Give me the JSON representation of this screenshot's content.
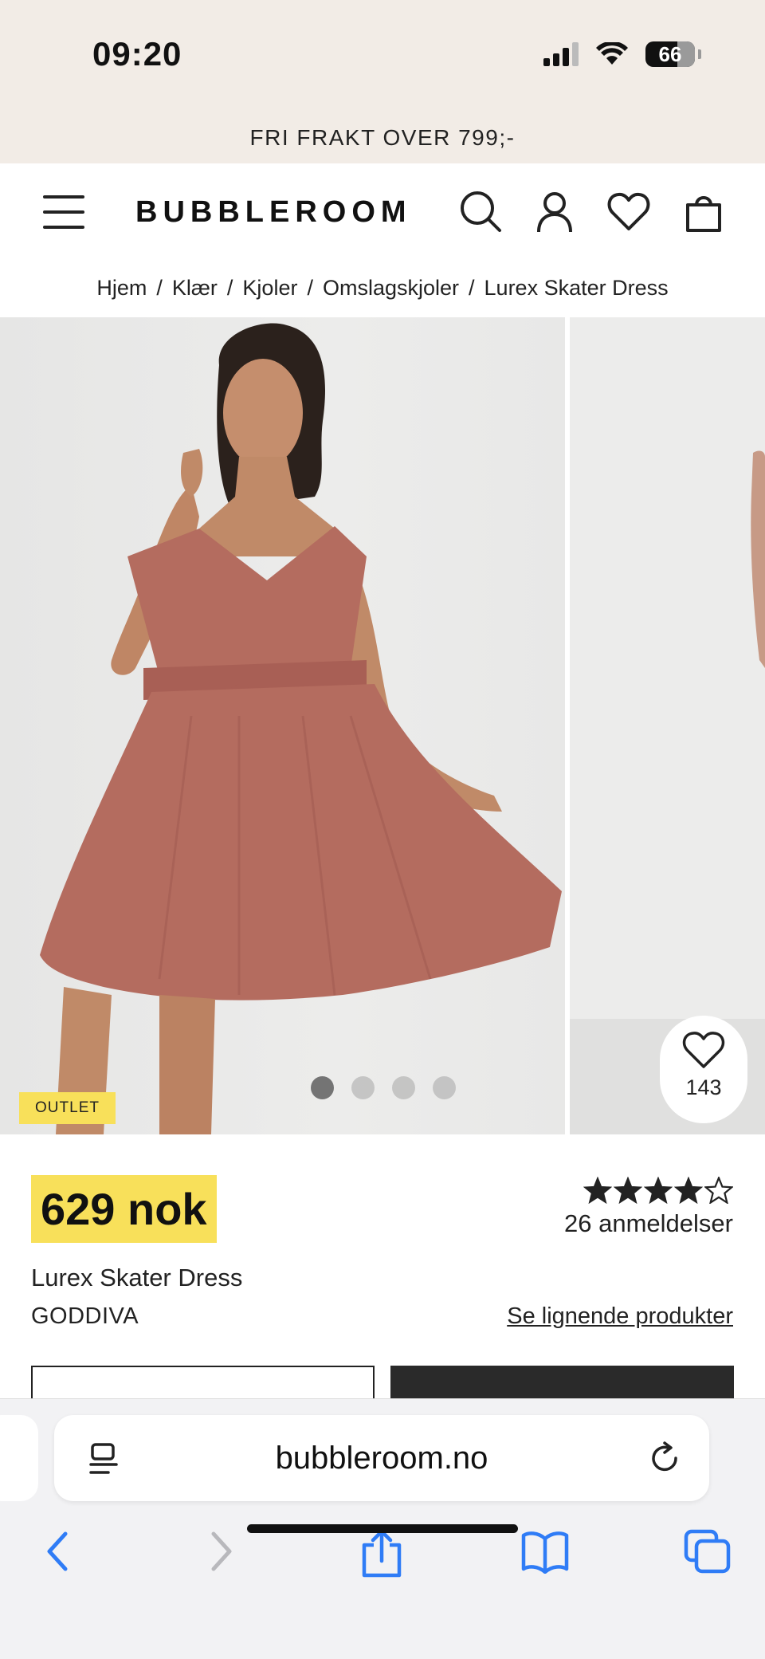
{
  "status_bar": {
    "time": "09:20",
    "battery": "66"
  },
  "promo": {
    "text": "FRI FRAKT OVER 799;-"
  },
  "header": {
    "logo": "BUBBLEROOM"
  },
  "breadcrumb": [
    "Hjem",
    "Klær",
    "Kjoler",
    "Omslagskjoler",
    "Lurex Skater Dress"
  ],
  "gallery": {
    "badge": "OUTLET",
    "favorite_count": "143",
    "slide_count": 4,
    "active_slide": 1
  },
  "product": {
    "price": "629 nok",
    "rating": 4,
    "rating_max": 5,
    "reviews": "26 anmeldelser",
    "name": "Lurex Skater Dress",
    "brand": "GODDIVA",
    "similar_link": "Se lignende produkter"
  },
  "browser": {
    "url": "bubbleroom.no"
  },
  "colors": {
    "promo_bg": "#f2ece6",
    "price_highlight": "#f8e05a",
    "dress": "#b46c5f",
    "accent_blue": "#2f7cf6"
  }
}
